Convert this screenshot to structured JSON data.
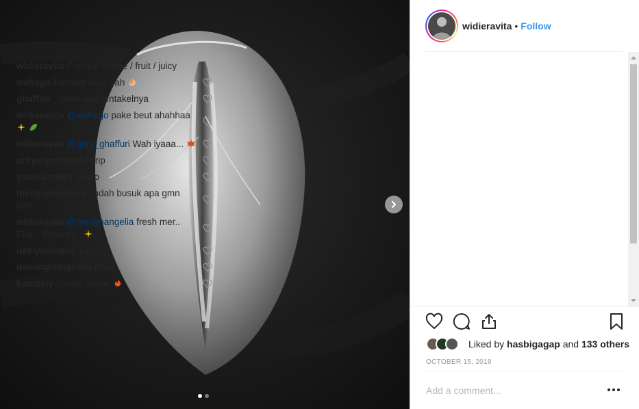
{
  "post": {
    "username": "widieravita",
    "separator": "•",
    "follow_label": "Follow",
    "date": "OCTOBER 15, 2018",
    "likes": {
      "prefix": "Liked by",
      "user": "hasbigagap",
      "middle": "and",
      "others": "133 others"
    },
    "add_comment_placeholder": "Add a comment...",
    "carousel": {
      "slide_count": 2,
      "active_slide": 1
    }
  },
  "caption": {
    "user": "widieravita",
    "text": "Familiar shape / fruit / juicy"
  },
  "comments": [
    {
      "user": "wahego",
      "text": "Familiar beut dah",
      "emoji": "ok-hand"
    },
    {
      "user": "ghaffuri_",
      "text": "Hmm ada tentakelnya"
    },
    {
      "user": "widieravita",
      "mention": "@wahego",
      "text": "pake beut ahahhaa",
      "emoji": "sparkles-leaf"
    },
    {
      "user": "widieravita",
      "mention": "@gary_ghaffuri",
      "text": "Wah iyaaa...",
      "emoji": "maple-leaf"
    },
    {
      "user": "arfiyanpratama",
      "text": "Mirip"
    },
    {
      "user": "yovie.syahrir",
      "text": "Sawo"
    },
    {
      "user": "merlynangelia",
      "text": "Ini udah busuk apa gmn dah"
    },
    {
      "user": "widieravita",
      "mention": "@merlynangelia",
      "text": "fresh mer.. Elah.. Enak ini..",
      "emoji": "sparkles"
    },
    {
      "user": "dekiyudhanto",
      "text": "juicy"
    },
    {
      "user": "danangcnugroho",
      "text": "Enak"
    },
    {
      "user": "komskiy",
      "text": "Lovely shape",
      "emoji": "fire"
    }
  ],
  "icons": {
    "heart": "heart-icon",
    "comment": "comment-icon",
    "share": "share-icon",
    "save": "bookmark-icon",
    "next": "chevron-right-icon",
    "more": "more-options-icon"
  },
  "colors": {
    "link": "#3897f0",
    "mention": "#003569",
    "muted": "#999999"
  }
}
